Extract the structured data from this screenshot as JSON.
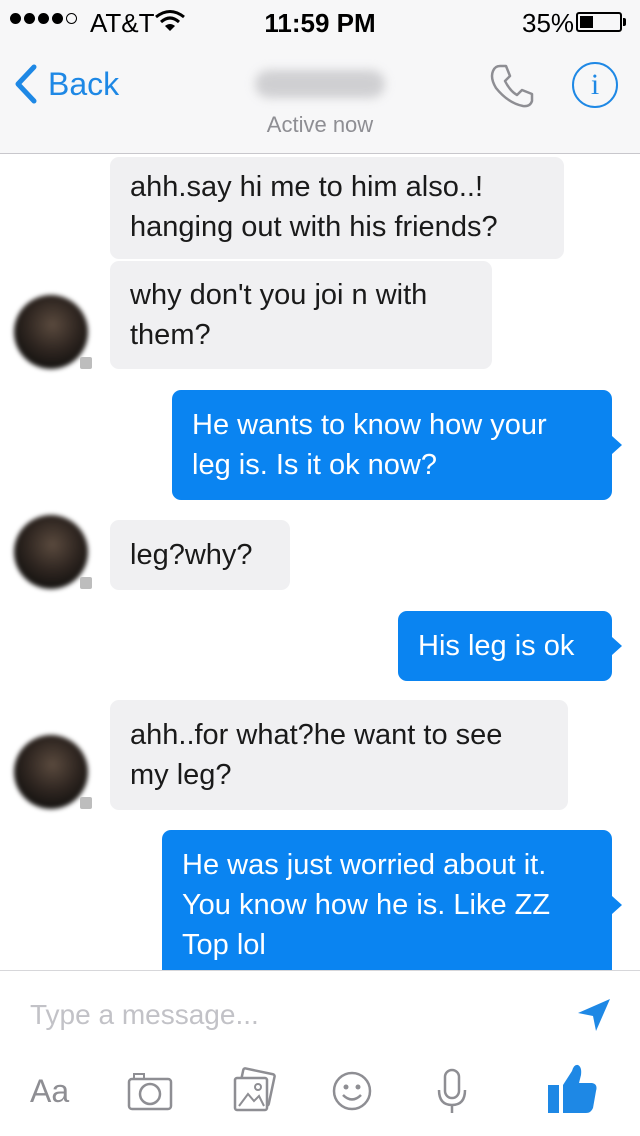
{
  "status_bar": {
    "carrier": "AT&T",
    "time": "11:59 PM",
    "battery_percent": "35%",
    "battery_level": 0.35,
    "signal_bars_filled": 4,
    "signal_bars_total": 5
  },
  "nav": {
    "back_label": "Back",
    "status": "Active now"
  },
  "messages": [
    {
      "direction": "in",
      "text": "ahh.say hi me to him also..!\nhanging out with his friends?"
    },
    {
      "direction": "in",
      "text": "why don't you joi n with\nthem?"
    },
    {
      "direction": "out",
      "text": "He wants to know how your\nleg is. Is it ok now?"
    },
    {
      "direction": "in",
      "text": "leg?why?"
    },
    {
      "direction": "out",
      "text": "His leg is ok"
    },
    {
      "direction": "in",
      "text": "ahh..for what?he want to see\nmy leg?"
    },
    {
      "direction": "out",
      "text": "He was just worried about it.\nYou know how he is. Like ZZ\nTop lol"
    }
  ],
  "composer": {
    "placeholder": "Type a message...",
    "text_tool_label": "Aa"
  },
  "colors": {
    "accent": "#1e88e5",
    "outgoing_bubble": "#0a84f1",
    "incoming_bubble": "#f0f0f2"
  },
  "icons": [
    "back-chevron-icon",
    "phone-icon",
    "info-icon",
    "send-icon",
    "camera-icon",
    "photo-gallery-icon",
    "emoji-icon",
    "microphone-icon",
    "thumbs-up-icon"
  ]
}
